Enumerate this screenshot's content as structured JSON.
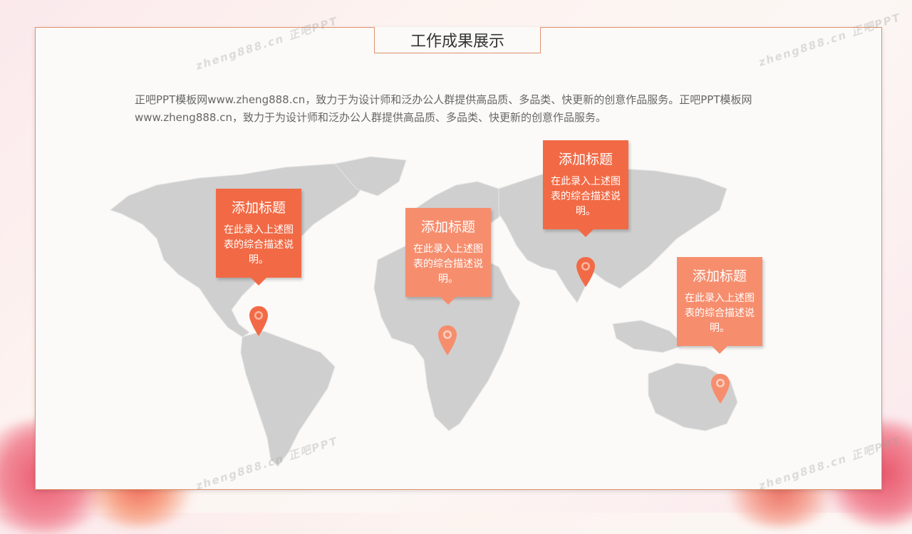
{
  "slide": {
    "title": "工作成果展示",
    "description": "正吧PPT模板网www.zheng888.cn，致力于为设计师和泛办公人群提供高品质、多品类、快更新的创意作品服务。正吧PPT模板网www.zheng888.cn，致力于为设计师和泛办公人群提供高品质、多品类、快更新的创意作品服务。"
  },
  "callouts": [
    {
      "title": "添加标题",
      "body": "在此录入上述图表的综合描述说明。",
      "color": "#f26a45"
    },
    {
      "title": "添加标题",
      "body": "在此录入上述图表的综合描述说明。",
      "color": "#f68e6e"
    },
    {
      "title": "添加标题",
      "body": "在此录入上述图表的综合描述说明。",
      "color": "#f26a45"
    },
    {
      "title": "添加标题",
      "body": "在此录入上述图表的综合描述说明。",
      "color": "#f68e6e"
    }
  ],
  "watermarks": [
    "zheng888.cn 正吧PPT",
    "zheng888.cn 正吧PPT",
    "zheng888.cn 正吧PPT",
    "zheng888.cn 正吧PPT"
  ],
  "colors": {
    "accent": "#f26a45",
    "accent_light": "#f68e6e",
    "map": "#cfcfcf",
    "border": "#e0906c"
  },
  "icons": [
    "location-pin-icon"
  ]
}
